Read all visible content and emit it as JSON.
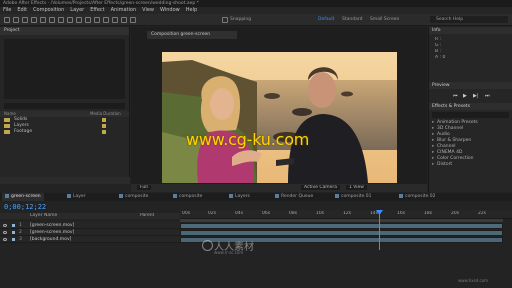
{
  "window": {
    "title": "Adobe After Effects - /Volumes/Projects/After Effects/green-screen/wedding-shoot.aep *"
  },
  "menu": [
    "File",
    "Edit",
    "Composition",
    "Layer",
    "Effect",
    "Animation",
    "View",
    "Window",
    "Help"
  ],
  "toolbar": {
    "snapping_label": "Snapping",
    "workspaces": [
      "Default",
      "Standard",
      "Small Screen"
    ],
    "active_workspace": "Default",
    "search_placeholder": "Search Help"
  },
  "project_panel": {
    "tab": "Project",
    "columns": {
      "name": "Name",
      "type": "Media Duration"
    },
    "items": [
      {
        "name": "Solids",
        "color": "#c2a84c"
      },
      {
        "name": "Layers",
        "color": "#c2a84c"
      },
      {
        "name": "Footage",
        "color": "#c2a84c"
      }
    ]
  },
  "composition_viewer": {
    "tab": "Composition green-screen",
    "zoom": "Full",
    "camera": "Active Camera",
    "views": "1 View"
  },
  "watermark": {
    "text": "www.cg-ku.com",
    "brand": "人人素材",
    "brand_url": "www.rr-sc.com",
    "corner": "www.hxsd.com"
  },
  "info_panel": {
    "tab": "Info",
    "readout": [
      "R :",
      "G :",
      "B :",
      "A : 0"
    ]
  },
  "preview_panel": {
    "tab": "Preview"
  },
  "effects_panel": {
    "tab": "Effects & Presets",
    "items": [
      "Animation Presets",
      "3D Channel",
      "Audio",
      "Blur & Sharpen",
      "Channel",
      "CINEMA 4D",
      "Color Correction",
      "Distort"
    ]
  },
  "timeline": {
    "tabs": [
      "green-screen",
      "Layer",
      "composite",
      "composite",
      "Layers",
      "Render Queue",
      "composite 01",
      "composite 02"
    ],
    "active_tab": "green-screen",
    "timecode": "0;00;12;22",
    "columns": {
      "name": "Layer Name",
      "parent": "Parent"
    },
    "layers": [
      {
        "number": "1",
        "name": "[green-screen.mov]",
        "color": "#8fb2d6"
      },
      {
        "number": "2",
        "name": "[green-screen.mov]",
        "color": "#8fb2d6"
      },
      {
        "number": "3",
        "name": "[background.mov]",
        "color": "#8fb2d6"
      }
    ],
    "ruler_ticks": [
      "00s",
      "02s",
      "04s",
      "06s",
      "08s",
      "10s",
      "12s",
      "14s",
      "16s",
      "18s",
      "20s",
      "22s"
    ]
  },
  "colors": {
    "accent": "#3b8dff",
    "timecode": "#4aa3ff",
    "watermark": "#ffd200"
  }
}
